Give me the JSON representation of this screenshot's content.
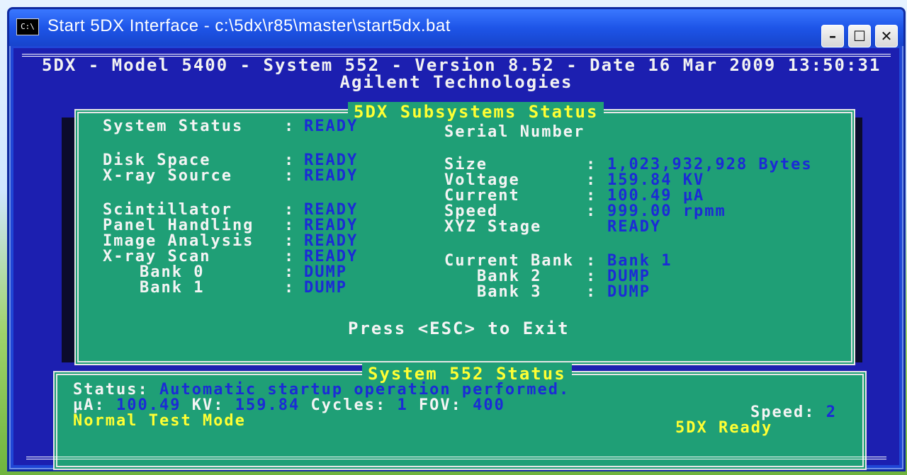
{
  "window": {
    "icon_label": "C:\\",
    "title": "Start 5DX Interface - c:\\5dx\\r85\\master\\start5dx.bat",
    "buttons": {
      "minimize": "–",
      "maximize": "☐",
      "close": "✕"
    }
  },
  "header": {
    "line1": "5DX - Model 5400 - System 552 - Version 8.52 - Date 16 Mar 2009 13:50:31",
    "line2": "Agilent Technologies"
  },
  "subsystems": {
    "title": "5DX Subsystems Status",
    "left": [
      {
        "label": "System Status",
        "value": "READY"
      },
      {
        "label": "Disk Space",
        "value": "READY"
      },
      {
        "label": "X-ray Source",
        "value": "READY"
      },
      {
        "label": "Scintillator",
        "value": "READY"
      },
      {
        "label": "Panel Handling",
        "value": "READY"
      },
      {
        "label": "Image Analysis",
        "value": "READY"
      },
      {
        "label": "X-ray Scan",
        "value": "READY"
      },
      {
        "label": "Bank 0",
        "value": "DUMP"
      },
      {
        "label": "Bank 1",
        "value": "DUMP"
      }
    ],
    "right": [
      {
        "label": "Serial Number",
        "value": ""
      },
      {
        "label": "Size",
        "value": "1,023,932,928 Bytes"
      },
      {
        "label": "Voltage",
        "value": "159.84 KV"
      },
      {
        "label": "Current",
        "value": "100.49 µA"
      },
      {
        "label": "Speed",
        "value": "999.00 rpmm"
      },
      {
        "label": "XYZ Stage",
        "value": "READY"
      },
      {
        "label": "Current Bank",
        "value": "Bank 1"
      },
      {
        "label": "Bank 2",
        "value": "DUMP"
      },
      {
        "label": "Bank 3",
        "value": "DUMP"
      }
    ],
    "separator": ":",
    "exit_text": "Press <ESC> to Exit"
  },
  "system_status": {
    "title": "System 552 Status",
    "status_label": "Status:",
    "status_text": "Automatic startup operation performed.",
    "ua_label": "µA:",
    "ua_value": "100.49",
    "kv_label": "KV:",
    "kv_value": "159.84",
    "cycles_label": "Cycles:",
    "cycles_value": "1",
    "fov_label": "FOV:",
    "fov_value": "400",
    "speed_label": "Speed:",
    "speed_value": "2",
    "mode": "Normal Test Mode",
    "ready": "5DX Ready"
  },
  "colors": {
    "console_bg": "#1c1fb0",
    "panel_bg": "#1f9f76",
    "label": "#f4f4f4",
    "value": "#1b2bd6",
    "highlight": "#ffff33"
  }
}
